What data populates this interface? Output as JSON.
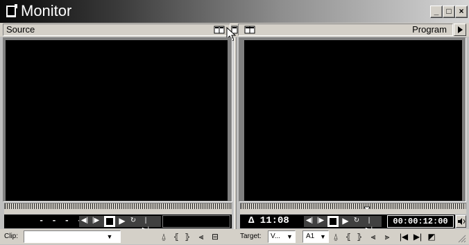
{
  "window": {
    "title": "Monitor",
    "minimize": "_",
    "maximize": "□",
    "close": "×"
  },
  "source": {
    "label": "Source",
    "timecode": "- - - -",
    "view_icon": "dual-view-icon"
  },
  "program": {
    "label": "Program",
    "delta_timecode": "Δ 11:08",
    "timecode": "00:00:12:00"
  },
  "bottom": {
    "clip_label": "Clip:",
    "target_label": "Target:",
    "target_video": "V...",
    "target_audio": "A1"
  },
  "transport_icons": [
    "step-back",
    "step-forward",
    "stop",
    "play",
    "loop",
    "play-edit"
  ],
  "colors": {
    "screen": "#000000",
    "panel": "#c0c0c0",
    "timecode": "#ffffff"
  }
}
